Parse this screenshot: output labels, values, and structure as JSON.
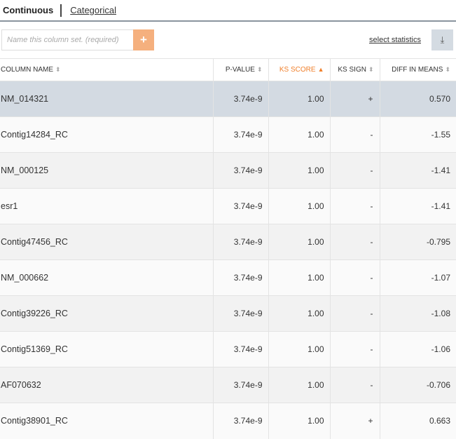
{
  "tabs": {
    "active": "Continuous",
    "other": "Categorical"
  },
  "toolbar": {
    "name_placeholder": "Name this column set. (required)",
    "add_label": "+",
    "select_statistics": "select statistics",
    "download_icon": "download-icon"
  },
  "colors": {
    "accent": "#f07f2a",
    "add_button": "#f5b07e",
    "selected_row": "#d3dae2"
  },
  "table": {
    "headers": [
      "COLUMN NAME",
      "P-VALUE",
      "KS SCORE",
      "KS SIGN",
      "DIFF IN MEANS"
    ],
    "sorted_by": "KS SCORE",
    "sort_direction": "descending",
    "rows": [
      [
        "NM_014321",
        "3.74e-9",
        "1.00",
        "+",
        "0.570"
      ],
      [
        "Contig14284_RC",
        "3.74e-9",
        "1.00",
        "-",
        "-1.55"
      ],
      [
        "NM_000125",
        "3.74e-9",
        "1.00",
        "-",
        "-1.41"
      ],
      [
        "esr1",
        "3.74e-9",
        "1.00",
        "-",
        "-1.41"
      ],
      [
        "Contig47456_RC",
        "3.74e-9",
        "1.00",
        "-",
        "-0.795"
      ],
      [
        "NM_000662",
        "3.74e-9",
        "1.00",
        "-",
        "-1.07"
      ],
      [
        "Contig39226_RC",
        "3.74e-9",
        "1.00",
        "-",
        "-1.08"
      ],
      [
        "Contig51369_RC",
        "3.74e-9",
        "1.00",
        "-",
        "-1.06"
      ],
      [
        "AF070632",
        "3.74e-9",
        "1.00",
        "-",
        "-0.706"
      ],
      [
        "Contig38901_RC",
        "3.74e-9",
        "1.00",
        "+",
        "0.663"
      ]
    ],
    "selected_row": 0
  }
}
